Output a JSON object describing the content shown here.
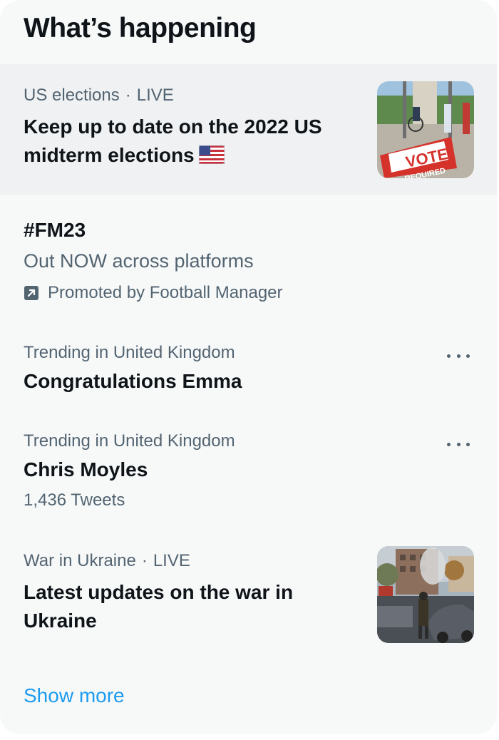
{
  "header": {
    "title": "What’s happening"
  },
  "trends": [
    {
      "category": "US elections",
      "separator": "·",
      "status": "LIVE",
      "title": "Keep up to date on the 2022 US midterm elections",
      "image": "vote-sign-photo",
      "image_text": "VOTE",
      "image_subtext": "REQUIRED",
      "icon": "us-flag-icon"
    },
    {
      "title": "#FM23",
      "subtitle": "Out NOW across platforms",
      "promoted_label": "Promoted by Football Manager",
      "icon": "promoted-icon"
    },
    {
      "category": "Trending in United Kingdom",
      "title": "Congratulations Emma",
      "icon": "more-icon"
    },
    {
      "category": "Trending in United Kingdom",
      "title": "Chris Moyles",
      "count": "1,436 Tweets",
      "icon": "more-icon"
    },
    {
      "category": "War in Ukraine",
      "separator": "·",
      "status": "LIVE",
      "title_line1": "Latest updates on the war in",
      "title_line2": "Ukraine",
      "image": "ukraine-street-photo"
    }
  ],
  "footer": {
    "show_more": "Show more"
  },
  "colors": {
    "accent": "#1d9bf0",
    "text_primary": "#0f1419",
    "text_secondary": "#536471",
    "panel_bg": "#f7f9f9",
    "hover_bg": "#eff1f2"
  }
}
